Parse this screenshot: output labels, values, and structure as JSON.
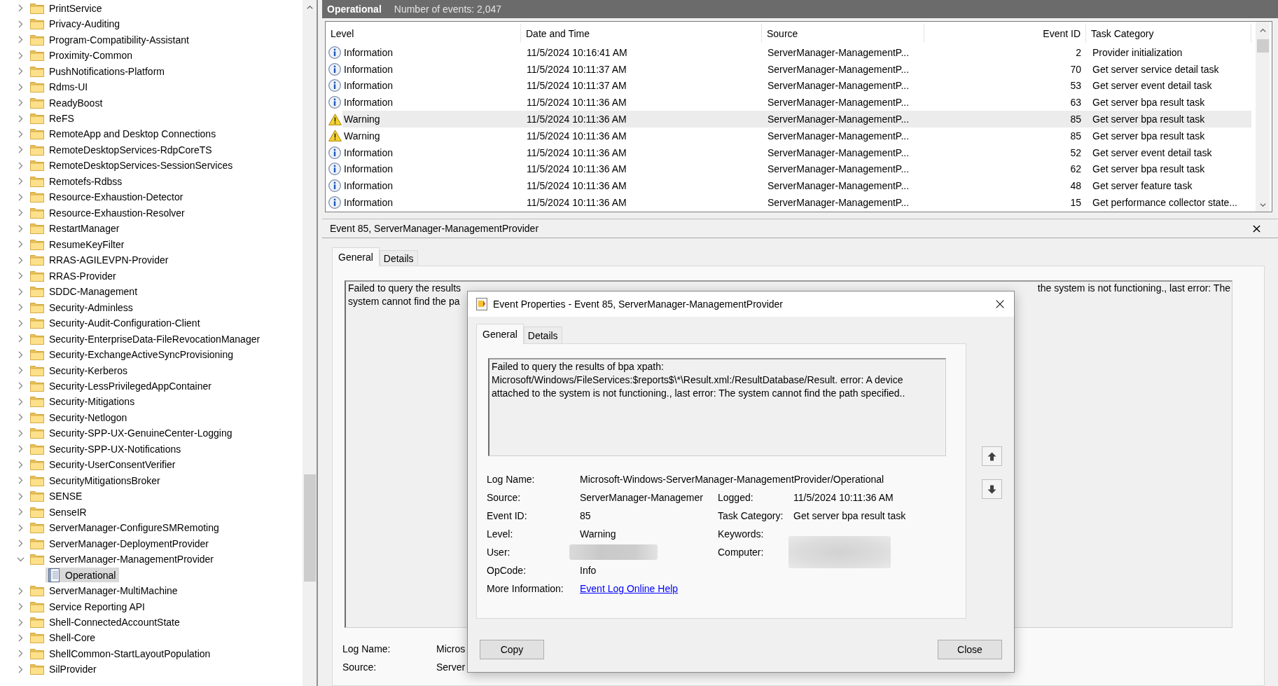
{
  "tree": {
    "items": [
      {
        "label": "PrintService",
        "kind": "folder",
        "expanded": false,
        "selected": false
      },
      {
        "label": "Privacy-Auditing",
        "kind": "folder",
        "expanded": false,
        "selected": false
      },
      {
        "label": "Program-Compatibility-Assistant",
        "kind": "folder",
        "expanded": false,
        "selected": false
      },
      {
        "label": "Proximity-Common",
        "kind": "folder",
        "expanded": false,
        "selected": false
      },
      {
        "label": "PushNotifications-Platform",
        "kind": "folder",
        "expanded": false,
        "selected": false
      },
      {
        "label": "Rdms-UI",
        "kind": "folder",
        "expanded": false,
        "selected": false
      },
      {
        "label": "ReadyBoost",
        "kind": "folder",
        "expanded": false,
        "selected": false
      },
      {
        "label": "ReFS",
        "kind": "folder",
        "expanded": false,
        "selected": false
      },
      {
        "label": "RemoteApp and Desktop Connections",
        "kind": "folder",
        "expanded": false,
        "selected": false
      },
      {
        "label": "RemoteDesktopServices-RdpCoreTS",
        "kind": "folder",
        "expanded": false,
        "selected": false
      },
      {
        "label": "RemoteDesktopServices-SessionServices",
        "kind": "folder",
        "expanded": false,
        "selected": false
      },
      {
        "label": "Remotefs-Rdbss",
        "kind": "folder",
        "expanded": false,
        "selected": false
      },
      {
        "label": "Resource-Exhaustion-Detector",
        "kind": "folder",
        "expanded": false,
        "selected": false
      },
      {
        "label": "Resource-Exhaustion-Resolver",
        "kind": "folder",
        "expanded": false,
        "selected": false
      },
      {
        "label": "RestartManager",
        "kind": "folder",
        "expanded": false,
        "selected": false
      },
      {
        "label": "ResumeKeyFilter",
        "kind": "folder",
        "expanded": false,
        "selected": false
      },
      {
        "label": "RRAS-AGILEVPN-Provider",
        "kind": "folder",
        "expanded": false,
        "selected": false
      },
      {
        "label": "RRAS-Provider",
        "kind": "folder",
        "expanded": false,
        "selected": false
      },
      {
        "label": "SDDC-Management",
        "kind": "folder",
        "expanded": false,
        "selected": false
      },
      {
        "label": "Security-Adminless",
        "kind": "folder",
        "expanded": false,
        "selected": false
      },
      {
        "label": "Security-Audit-Configuration-Client",
        "kind": "folder",
        "expanded": false,
        "selected": false
      },
      {
        "label": "Security-EnterpriseData-FileRevocationManager",
        "kind": "folder",
        "expanded": false,
        "selected": false
      },
      {
        "label": "Security-ExchangeActiveSyncProvisioning",
        "kind": "folder",
        "expanded": false,
        "selected": false
      },
      {
        "label": "Security-Kerberos",
        "kind": "folder",
        "expanded": false,
        "selected": false
      },
      {
        "label": "Security-LessPrivilegedAppContainer",
        "kind": "folder",
        "expanded": false,
        "selected": false
      },
      {
        "label": "Security-Mitigations",
        "kind": "folder",
        "expanded": false,
        "selected": false
      },
      {
        "label": "Security-Netlogon",
        "kind": "folder",
        "expanded": false,
        "selected": false
      },
      {
        "label": "Security-SPP-UX-GenuineCenter-Logging",
        "kind": "folder",
        "expanded": false,
        "selected": false
      },
      {
        "label": "Security-SPP-UX-Notifications",
        "kind": "folder",
        "expanded": false,
        "selected": false
      },
      {
        "label": "Security-UserConsentVerifier",
        "kind": "folder",
        "expanded": false,
        "selected": false
      },
      {
        "label": "SecurityMitigationsBroker",
        "kind": "folder",
        "expanded": false,
        "selected": false
      },
      {
        "label": "SENSE",
        "kind": "folder",
        "expanded": false,
        "selected": false
      },
      {
        "label": "SenseIR",
        "kind": "folder",
        "expanded": false,
        "selected": false
      },
      {
        "label": "ServerManager-ConfigureSMRemoting",
        "kind": "folder",
        "expanded": false,
        "selected": false
      },
      {
        "label": "ServerManager-DeploymentProvider",
        "kind": "folder",
        "expanded": false,
        "selected": false
      },
      {
        "label": "ServerManager-ManagementProvider",
        "kind": "folder",
        "expanded": true,
        "selected": false,
        "children": [
          {
            "label": "Operational",
            "kind": "log",
            "selected": true
          }
        ]
      },
      {
        "label": "ServerManager-MultiMachine",
        "kind": "folder",
        "expanded": false,
        "selected": false
      },
      {
        "label": "Service Reporting API",
        "kind": "folder",
        "expanded": false,
        "selected": false
      },
      {
        "label": "Shell-ConnectedAccountState",
        "kind": "folder",
        "expanded": false,
        "selected": false
      },
      {
        "label": "Shell-Core",
        "kind": "folder",
        "expanded": false,
        "selected": false
      },
      {
        "label": "ShellCommon-StartLayoutPopulation",
        "kind": "folder",
        "expanded": false,
        "selected": false
      },
      {
        "label": "SilProvider",
        "kind": "folder",
        "expanded": false,
        "selected": false
      }
    ]
  },
  "log_header": {
    "title": "Operational",
    "event_count": "Number of events: 2,047"
  },
  "events": {
    "columns": [
      "Level",
      "Date and Time",
      "Source",
      "Event ID",
      "Task Category"
    ],
    "rows": [
      {
        "kind": "information",
        "level": "Information",
        "date": "11/5/2024 10:16:41 AM",
        "source": "ServerManager-ManagementP...",
        "event_id": "2",
        "task": "Provider initialization",
        "selected": false
      },
      {
        "kind": "information",
        "level": "Information",
        "date": "11/5/2024 10:11:37 AM",
        "source": "ServerManager-ManagementP...",
        "event_id": "70",
        "task": "Get server service detail task",
        "selected": false
      },
      {
        "kind": "information",
        "level": "Information",
        "date": "11/5/2024 10:11:37 AM",
        "source": "ServerManager-ManagementP...",
        "event_id": "53",
        "task": "Get server event detail task",
        "selected": false
      },
      {
        "kind": "information",
        "level": "Information",
        "date": "11/5/2024 10:11:36 AM",
        "source": "ServerManager-ManagementP...",
        "event_id": "63",
        "task": "Get server bpa result task",
        "selected": false
      },
      {
        "kind": "warning",
        "level": "Warning",
        "date": "11/5/2024 10:11:36 AM",
        "source": "ServerManager-ManagementP...",
        "event_id": "85",
        "task": "Get server bpa result task",
        "selected": true
      },
      {
        "kind": "warning",
        "level": "Warning",
        "date": "11/5/2024 10:11:36 AM",
        "source": "ServerManager-ManagementP...",
        "event_id": "85",
        "task": "Get server bpa result task",
        "selected": false
      },
      {
        "kind": "information",
        "level": "Information",
        "date": "11/5/2024 10:11:36 AM",
        "source": "ServerManager-ManagementP...",
        "event_id": "52",
        "task": "Get server event detail task",
        "selected": false
      },
      {
        "kind": "information",
        "level": "Information",
        "date": "11/5/2024 10:11:36 AM",
        "source": "ServerManager-ManagementP...",
        "event_id": "62",
        "task": "Get server bpa result task",
        "selected": false
      },
      {
        "kind": "information",
        "level": "Information",
        "date": "11/5/2024 10:11:36 AM",
        "source": "ServerManager-ManagementP...",
        "event_id": "48",
        "task": "Get server feature task",
        "selected": false
      },
      {
        "kind": "information",
        "level": "Information",
        "date": "11/5/2024 10:11:36 AM",
        "source": "ServerManager-ManagementP...",
        "event_id": "15",
        "task": "Get performance collector state...",
        "selected": false
      }
    ]
  },
  "detail": {
    "title": "Event 85, ServerManager-ManagementProvider",
    "tabs": [
      {
        "label": "General",
        "selected": true
      },
      {
        "label": "Details",
        "selected": false
      }
    ],
    "description": {
      "line_1_start": "Failed to query the results",
      "line_1_end": "the system is not functioning., last error: The",
      "line_2_start": "system cannot find the pa"
    },
    "fields": [
      {
        "label": "Log Name:",
        "value": "Micros"
      },
      {
        "label": "Source:",
        "value": "Server"
      }
    ]
  },
  "dialog": {
    "title": "Event Properties - Event 85, ServerManager-ManagementProvider",
    "tabs": [
      {
        "label": "General",
        "selected": true
      },
      {
        "label": "Details",
        "selected": false
      }
    ],
    "description": "Failed to query the results of bpa xpath: Microsoft/Windows/FileServices:$reports$\\*\\Result.xml:/ResultDatabase/Result. error: A device attached to the system is not functioning., last error: The system cannot find the path specified..",
    "field_rows": [
      [
        {
          "label": "Log Name:",
          "kind": "text",
          "value": "Microsoft-Windows-ServerManager-ManagementProvider/Operational"
        }
      ],
      [
        {
          "label": "Source:",
          "kind": "text",
          "value": "ServerManager-Managemer"
        },
        {
          "label": "Logged:",
          "kind": "text",
          "value": "11/5/2024 10:11:36 AM"
        }
      ],
      [
        {
          "label": "Event ID:",
          "kind": "text",
          "value": "85"
        },
        {
          "label": "Task Category:",
          "kind": "text",
          "value": "Get server bpa result task"
        }
      ],
      [
        {
          "label": "Level:",
          "kind": "text",
          "value": "Warning"
        },
        {
          "label": "Keywords:",
          "kind": "text"
        }
      ],
      [
        {
          "label": "User:",
          "kind": "redacted"
        },
        {
          "label": "Computer:",
          "kind": "redacted"
        }
      ],
      [
        {
          "label": "OpCode:",
          "kind": "text",
          "value": "Info"
        }
      ],
      [
        {
          "label": "More Information:",
          "kind": "link",
          "value": "Event Log Online Help"
        }
      ]
    ],
    "buttons": [
      "Copy",
      "Close"
    ]
  }
}
